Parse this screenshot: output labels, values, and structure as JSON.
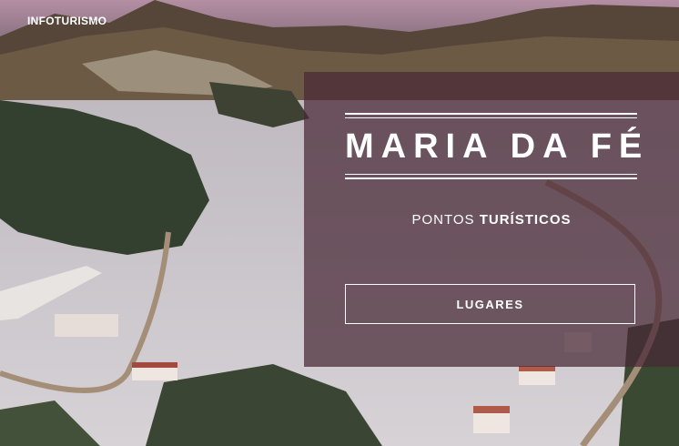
{
  "brand": "INFOTURISMO",
  "hero": {
    "title": "MARIA DA FÉ",
    "subtitle_light": "PONTOS ",
    "subtitle_bold": "TURÍSTICOS",
    "button_label": "LUGARES"
  },
  "colors": {
    "panel": "#482836",
    "sky": "#9a8092",
    "hills": "#4a3a30",
    "frost": "#c9c5cc",
    "trees": "#2f3a2a",
    "road": "#a88f7a"
  }
}
